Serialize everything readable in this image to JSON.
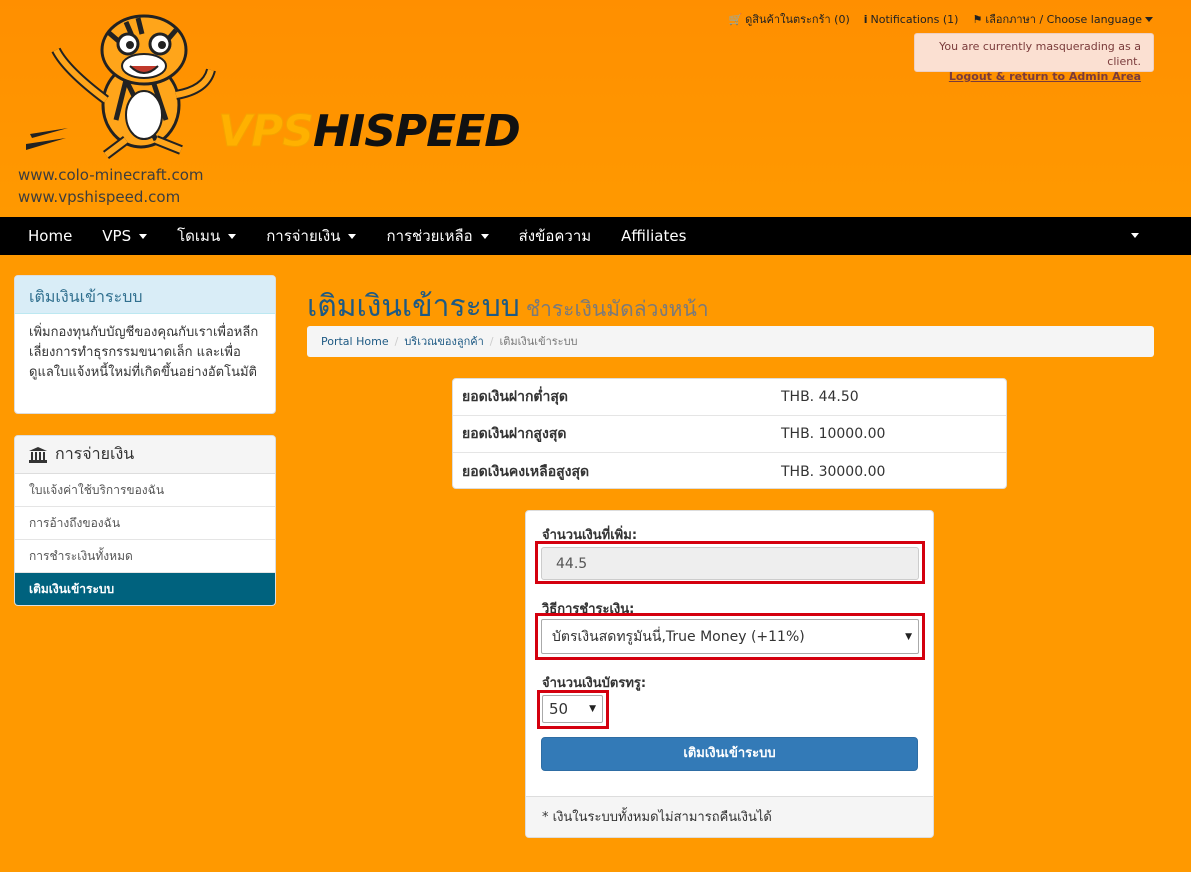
{
  "header": {
    "logo_part1": "VPS",
    "logo_part2": "HISPEED",
    "site_link_1": "www.colo-minecraft.com",
    "site_link_2": "www.vpshispeed.com",
    "cart": "ดูสินค้าในตระกร้า (0)",
    "notifications": "Notifications (1)",
    "language": "เลือกภาษา / Choose language",
    "masquerade_text": "You are currently masquerading as a client.",
    "masquerade_logout": "Logout & return to Admin Area"
  },
  "nav": {
    "items": [
      "Home",
      "VPS",
      "โดเมน",
      "การจ่ายเงิน",
      "การช่วยเหลือ",
      "ส่งข้อความ",
      "Affiliates"
    ]
  },
  "sidebar": {
    "add_funds_title": "เติมเงินเข้าระบบ",
    "add_funds_desc": "เพิ่มกองทุนกับบัญชีของคุณกับเราเพื่อหลีกเลี่ยงการทำธุรกรรมขนาดเล็ก และเพื่อดูแลใบแจ้งหนี้ใหม่ที่เกิดขึ้นอย่างอัตโนมัติ",
    "billing_title": "การจ่ายเงิน",
    "billing_items": [
      "ใบแจ้งค่าใช้บริการของฉัน",
      "การอ้างถึงของฉัน",
      "การชำระเงินทั้งหมด",
      "เติมเงินเข้าระบบ"
    ]
  },
  "main": {
    "title": "เติมเงินเข้าระบบ",
    "subtitle": "ชำระเงินมัดล่วงหน้า",
    "breadcrumb": [
      "Portal Home",
      "บริเวณของลูกค้า",
      "เติมเงินเข้าระบบ"
    ],
    "limits": [
      {
        "label": "ยอดเงินฝากต่ำสุด",
        "value": "THB. 44.50"
      },
      {
        "label": "ยอดเงินฝากสูงสุด",
        "value": "THB. 10000.00"
      },
      {
        "label": "ยอดเงินคงเหลือสูงสุด",
        "value": "THB. 30000.00"
      }
    ],
    "form": {
      "amount_label": "จำนวนเงินที่เพิ่ม:",
      "amount_value": "44.5",
      "method_label": "วิธีการชำระเงิน:",
      "method_value": "บัตรเงินสดทรูมันนี่,True Money (+11%)",
      "card_label": "จำนวนเงินบัตรทรู:",
      "card_value": "50",
      "submit": "เติมเงินเข้าระบบ",
      "footer_note": "* เงินในระบบทั้งหมดไม่สามารถคืนเงินได้"
    }
  },
  "colors": {
    "background": "#ff9900",
    "navbar": "#000000",
    "primary_button": "#337ab7",
    "active_item": "#00627e",
    "highlight": "#d4000e"
  }
}
